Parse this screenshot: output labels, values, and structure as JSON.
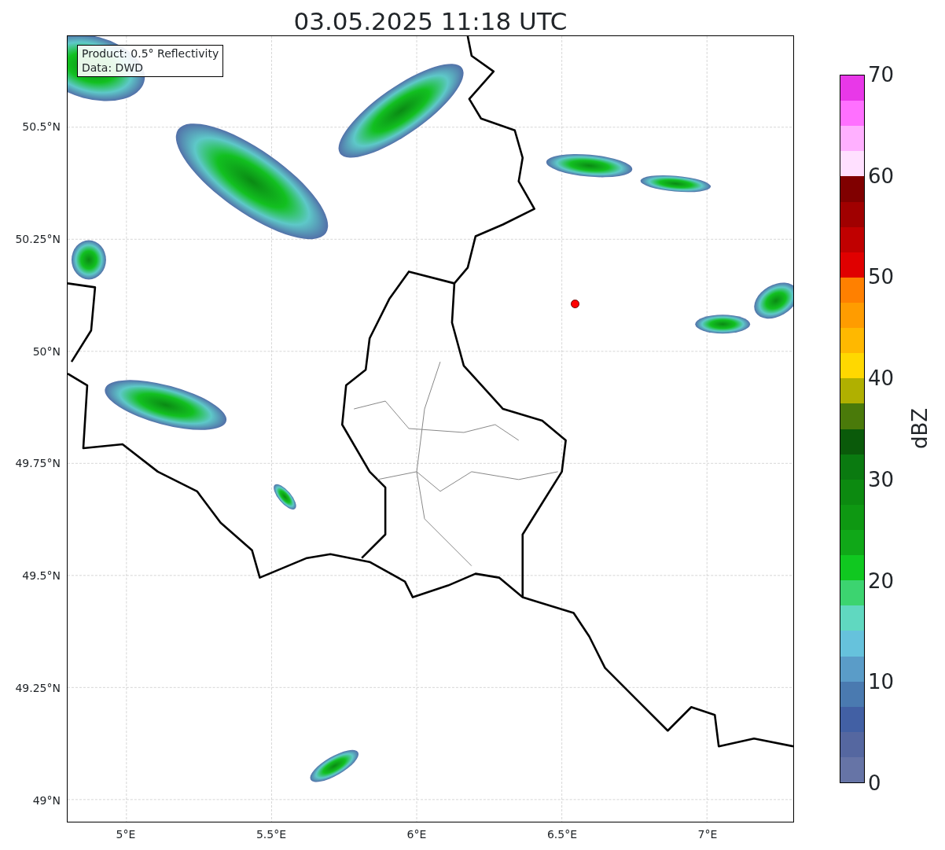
{
  "title": "03.05.2025 11:18 UTC",
  "map": {
    "info_lines": [
      "Product: 0.5° Reflectivity",
      "Data: DWD"
    ],
    "y_ticks": [
      "50.5°N",
      "50.25°N",
      "50°N",
      "49.75°N",
      "49.5°N",
      "49.25°N",
      "49°N"
    ],
    "x_ticks": [
      "5°E",
      "5.5°E",
      "6°E",
      "6.5°E",
      "7°E"
    ]
  },
  "colorbar": {
    "label": "dBZ",
    "ticks": [
      "70",
      "60",
      "50",
      "40",
      "30",
      "20",
      "10",
      "0"
    ],
    "segments": [
      {
        "color": "#e838e8"
      },
      {
        "color": "#ff70ff"
      },
      {
        "color": "#ffb0ff"
      },
      {
        "color": "#ffe0ff"
      },
      {
        "color": "#800000"
      },
      {
        "color": "#a00000"
      },
      {
        "color": "#c00000"
      },
      {
        "color": "#e00000"
      },
      {
        "color": "#ff8000"
      },
      {
        "color": "#ff9c00"
      },
      {
        "color": "#ffb800"
      },
      {
        "color": "#ffd800"
      },
      {
        "color": "#b0b000"
      },
      {
        "color": "#4a7a0a"
      },
      {
        "color": "#0a5a0a"
      },
      {
        "color": "#0a7a10"
      },
      {
        "color": "#0c8a10"
      },
      {
        "color": "#0e9812"
      },
      {
        "color": "#10a818"
      },
      {
        "color": "#10c820"
      },
      {
        "color": "#3cd470"
      },
      {
        "color": "#60d8c0"
      },
      {
        "color": "#66c2dc"
      },
      {
        "color": "#5a9cc8"
      },
      {
        "color": "#4a7ab0"
      },
      {
        "color": "#4260a4"
      },
      {
        "color": "#5567a0"
      },
      {
        "color": "#6674a6"
      }
    ]
  }
}
